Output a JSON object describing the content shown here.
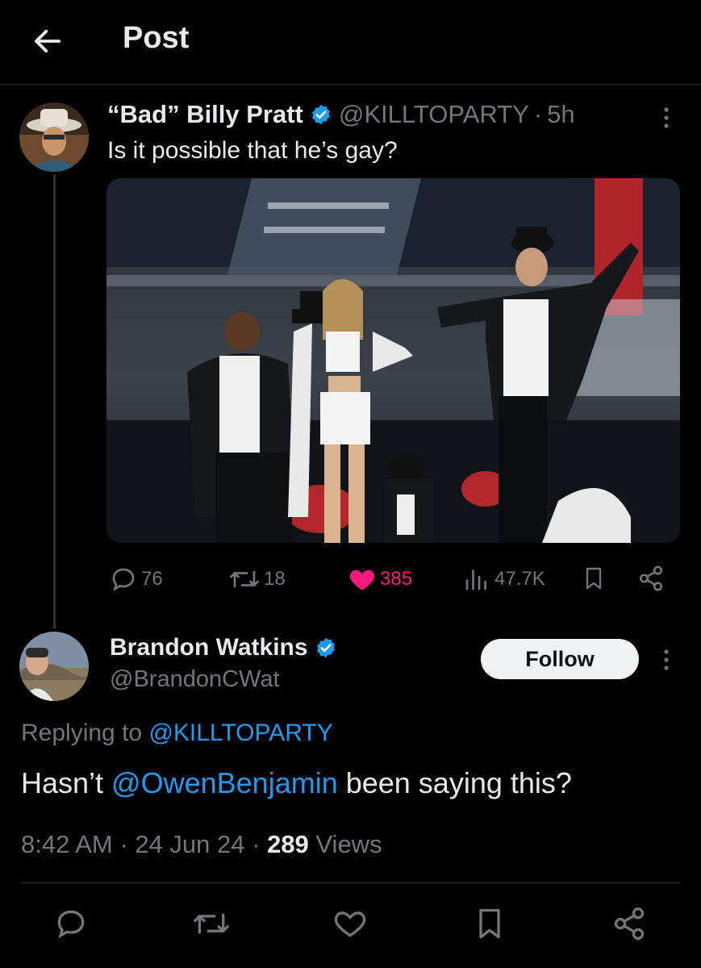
{
  "header": {
    "title": "Post",
    "back_icon": "arrow-left-icon"
  },
  "tweet": {
    "display_name": "“Bad” Billy Pratt",
    "handle": "@KILLTOPARTY",
    "separator": "·",
    "time": "5h",
    "text": "Is it possible that he’s gay?",
    "stats": {
      "replies": "76",
      "reposts": "18",
      "likes": "385",
      "views": "47.7K"
    }
  },
  "reply": {
    "display_name": "Brandon Watkins",
    "handle": "@BrandonCWat",
    "follow_label": "Follow",
    "replying_prefix": "Replying to",
    "replying_to": "@KILLTOPARTY",
    "text_before": "Hasn’t ",
    "mention": "@OwenBenjamin",
    "text_after": " been saying this?",
    "time": "8:42 AM",
    "date": "24 Jun 24",
    "dot": "·",
    "views_count": "289",
    "views_label": "Views"
  },
  "colors": {
    "accent": "#1d9bf0",
    "like": "#f91880",
    "muted": "#71767b",
    "background": "#000000"
  }
}
